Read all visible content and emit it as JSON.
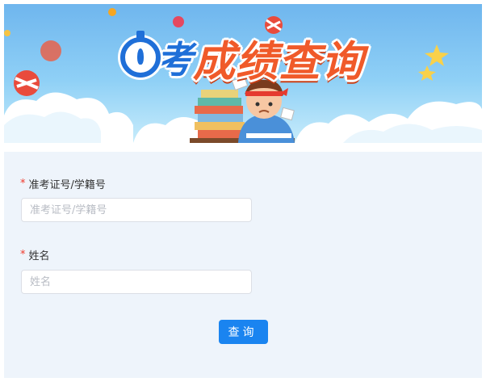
{
  "banner": {
    "logo_char": "考",
    "title": "成绩查询"
  },
  "form": {
    "fields": [
      {
        "required_mark": "*",
        "label": "准考证号/学籍号",
        "placeholder": "准考证号/学籍号",
        "value": ""
      },
      {
        "required_mark": "*",
        "label": "姓名",
        "placeholder": "姓名",
        "value": ""
      }
    ],
    "submit_label": "查询"
  },
  "colors": {
    "accent": "#1a84f0",
    "title_orange": "#f05a2a",
    "logo_blue": "#1f6fd8",
    "required": "#f0392b",
    "form_bg": "#eef4fb"
  }
}
